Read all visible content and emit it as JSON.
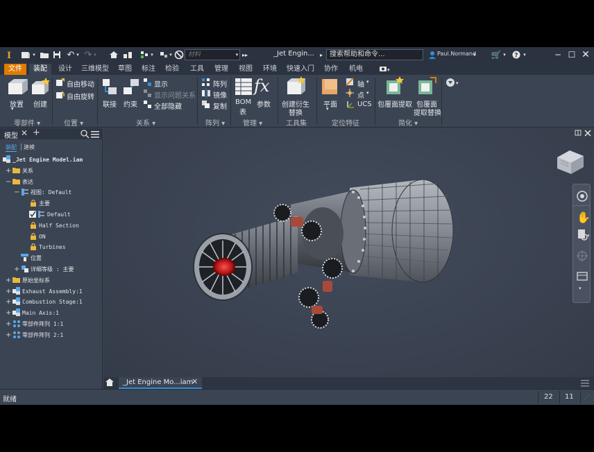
{
  "titlebar": {
    "material_placeholder": "材料",
    "doc_title": "_Jet Engin...",
    "search_placeholder": "搜索帮助和命令...",
    "user": "Paul.Normand"
  },
  "tabs": [
    {
      "label": "文件",
      "state": "file"
    },
    {
      "label": "装配",
      "state": "active"
    },
    {
      "label": "设计"
    },
    {
      "label": "三维模型"
    },
    {
      "label": "草图"
    },
    {
      "label": "标注"
    },
    {
      "label": "检验"
    },
    {
      "label": "工具"
    },
    {
      "label": "管理"
    },
    {
      "label": "视图"
    },
    {
      "label": "环境"
    },
    {
      "label": "快速入门"
    },
    {
      "label": "协作"
    },
    {
      "label": "机电"
    }
  ],
  "ribbon": {
    "place": "放置",
    "create": "创建",
    "free_move": "自由移动",
    "free_rotate": "自由旋转",
    "join": "联接",
    "constrain": "约束",
    "show": "显示",
    "show_problem": "显示问题关系",
    "show_all": "全部隐藏",
    "pattern": "阵列",
    "mirror": "镜像",
    "copy": "复制",
    "bom": "BOM",
    "bom2": "表",
    "params": "参数",
    "derive1": "创建衍生",
    "derive2": "替换",
    "plane": "平面",
    "axis": "轴",
    "point": "点",
    "ucs": "UCS",
    "shrinkwrap": "包覆面提取",
    "shrinkwrap_sub1": "包覆面",
    "shrinkwrap_sub2": "提取替换",
    "groups": {
      "component": "零部件 ▾",
      "position": "位置 ▾",
      "relationships": "关系 ▾",
      "pattern": "阵列 ▾",
      "manage": "管理 ▾",
      "toolset": "工具集",
      "work_features": "定位特征",
      "simplify": "简化 ▾"
    }
  },
  "panel": {
    "title": "模型",
    "tab_assembly": "装配",
    "tab_model": "建模",
    "tree": [
      {
        "label": "_Jet Engine Model.iam",
        "indent": 0,
        "exp": "",
        "icon": "assembly-icon",
        "bold": true
      },
      {
        "label": "关系",
        "indent": 1,
        "exp": "+",
        "icon": "folder-icon"
      },
      {
        "label": "表达",
        "indent": 1,
        "exp": "−",
        "icon": "folder-icon"
      },
      {
        "label": "视图: Default",
        "indent": 2,
        "exp": "−",
        "icon": "view-icon"
      },
      {
        "label": "主要",
        "indent": 3,
        "exp": "",
        "icon": "lock-icon"
      },
      {
        "label": "Default",
        "indent": 3,
        "exp": "",
        "icon": "view-check-icon"
      },
      {
        "label": "Half Section",
        "indent": 3,
        "exp": "",
        "icon": "lock-icon"
      },
      {
        "label": "ON",
        "indent": 3,
        "exp": "",
        "icon": "lock-icon"
      },
      {
        "label": "Turbines",
        "indent": 3,
        "exp": "",
        "icon": "lock-icon"
      },
      {
        "label": "位置",
        "indent": 2,
        "exp": "",
        "icon": "position-icon"
      },
      {
        "label": "详细等级 : 主要",
        "indent": 2,
        "exp": "+",
        "icon": "lod-icon"
      },
      {
        "label": "原始坐标系",
        "indent": 1,
        "exp": "+",
        "icon": "folder-icon"
      },
      {
        "label": "Exhaust Assembly:1",
        "indent": 1,
        "exp": "+",
        "icon": "assembly-icon"
      },
      {
        "label": "Combustion Stage:1",
        "indent": 1,
        "exp": "+",
        "icon": "assembly-icon"
      },
      {
        "label": "Main Axis:1",
        "indent": 1,
        "exp": "+",
        "icon": "assembly-icon"
      },
      {
        "label": "零部件阵列 1:1",
        "indent": 1,
        "exp": "+",
        "icon": "pattern-icon"
      },
      {
        "label": "零部件阵列 2:1",
        "indent": 1,
        "exp": "+",
        "icon": "pattern-icon"
      }
    ]
  },
  "doc_tab": "_Jet Engine Mo...iam",
  "status": {
    "text": "就绪",
    "count1": "22",
    "count2": "11"
  },
  "colors": {
    "accent": "#e07b00",
    "active_tab_underline": "#2f8fd8",
    "background": "#3b4453"
  }
}
